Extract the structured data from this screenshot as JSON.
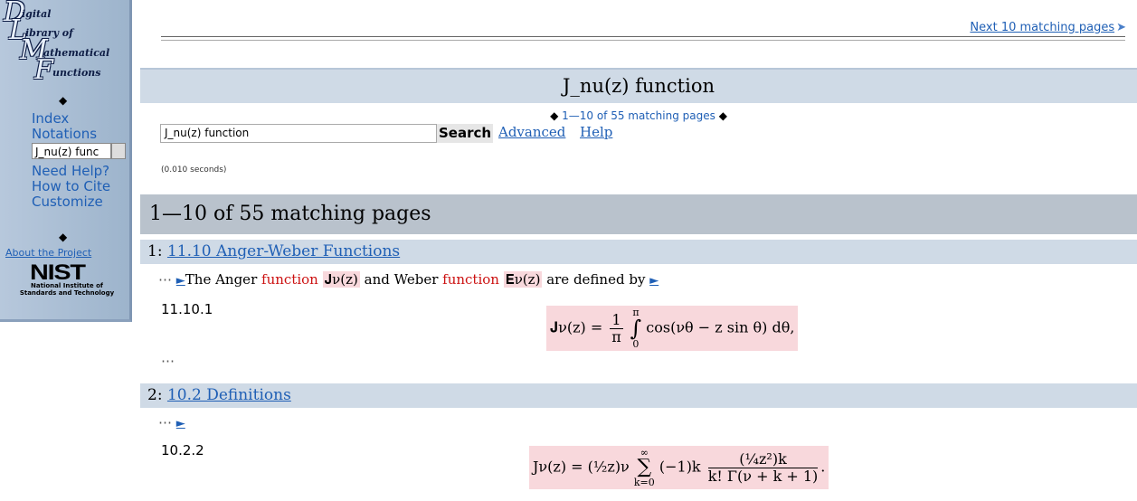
{
  "sidebar": {
    "logo": {
      "l1": "D",
      "l1b": "igital",
      "l2": "L",
      "l2b": "ibrary of",
      "l3": "M",
      "l3b": "athematical",
      "l4": "F",
      "l4b": "unctions"
    },
    "links": [
      "Index",
      "Notations"
    ],
    "search_value": "J_nu(z) func",
    "links2": [
      "Need Help?",
      "How to Cite",
      "Customize"
    ],
    "about": "About the Project",
    "nist": "NIST",
    "nist_sub1": "National Institute of",
    "nist_sub2": "Standards and Technology"
  },
  "nav": {
    "next_link": "Next 10 matching pages"
  },
  "page_title": "J_nu(z) function",
  "count_top": "1—10 of 55 matching pages",
  "search": {
    "value": "J_nu(z) function",
    "button": "Search",
    "advanced": "Advanced",
    "help": "Help"
  },
  "timing": "(0.010 seconds)",
  "results_header": "1—10 of 55 matching pages",
  "results": [
    {
      "num": "1:",
      "title": "11.10 Anger-Weber Functions",
      "snippet_pre": "The Anger ",
      "word1": "function",
      "sym1": "𝐉ν(z)",
      "mid": " and Weber ",
      "word2": "function",
      "sym2": "𝐄ν(z)",
      "post": " are defined by",
      "eq_num": "11.10.1",
      "eq_lhs": "𝐉ν(z) =",
      "eq_frac_num": "1",
      "eq_frac_den": "π",
      "eq_int_top": "π",
      "eq_int_bottom": "0",
      "eq_rhs": "cos(νθ − z sin θ) dθ,"
    },
    {
      "num": "2:",
      "title": "10.2 Definitions",
      "eq_num": "10.2.2",
      "eq_lhs": "Jν(z) = (½z)ν",
      "eq_sum_top": "∞",
      "eq_sum_bottom": "k=0",
      "eq_mid": "(−1)k",
      "eq_frac_num": "(¼z²)k",
      "eq_frac_den": "k! Γ(ν + k + 1)"
    }
  ],
  "ellipsis": "⋯"
}
